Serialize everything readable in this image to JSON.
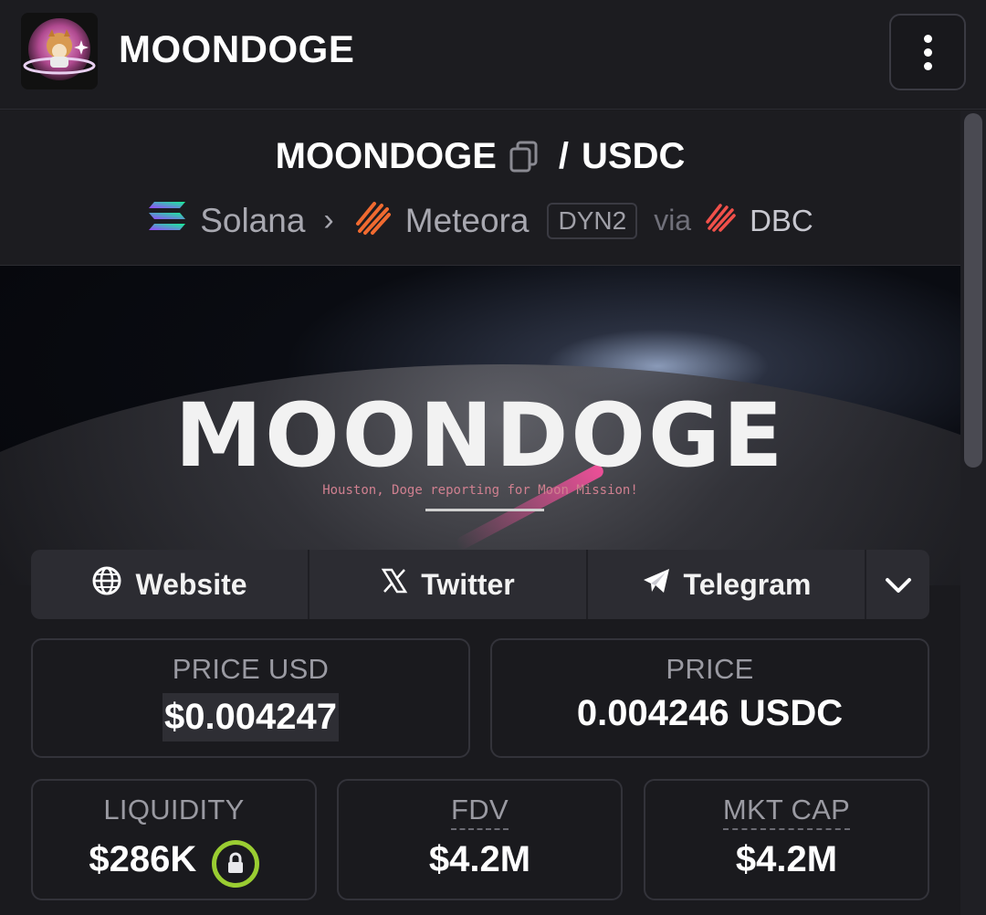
{
  "header": {
    "app_title": "MOONDOGE",
    "logo_icon": "doge-astronaut-logo",
    "menu_icon": "vertical-dots-menu-icon"
  },
  "pair": {
    "base": "MOONDOGE",
    "separator": "/",
    "quote": "USDC",
    "chain": "Solana",
    "dex": "Meteora",
    "pool_type": "DYN2",
    "via_label": "via",
    "via": "DBC"
  },
  "banner": {
    "title": "MOONDOGE",
    "tagline": "Houston, Doge reporting for Moon Mission!"
  },
  "social": {
    "website": "Website",
    "twitter": "Twitter",
    "telegram": "Telegram"
  },
  "stats": {
    "price_usd_label": "PRICE USD",
    "price_usd_value": "$0.004247",
    "price_label": "PRICE",
    "price_value": "0.004246 USDC",
    "liquidity_label": "LIQUIDITY",
    "liquidity_value": "$286K",
    "fdv_label": "FDV",
    "fdv_value": "$4.2M",
    "mktcap_label": "MKT CAP",
    "mktcap_value": "$4.2M"
  },
  "colors": {
    "background": "#1a1a1e",
    "card_border": "#33333a",
    "lock_green": "#9acd32",
    "solana_gradient": [
      "#14f195",
      "#9945ff"
    ],
    "meteora_orange": "#f06a30",
    "dbc_red": "#f0504a"
  }
}
